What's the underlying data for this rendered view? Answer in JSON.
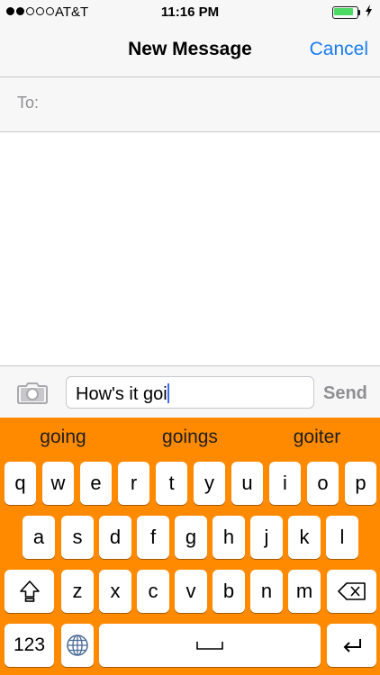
{
  "status_bar": {
    "signal_filled": 2,
    "signal_total": 5,
    "carrier": "AT&T",
    "time": "11:16 PM",
    "battery_level": 0.9,
    "battery_color": "#4cd964",
    "charging_icon": "bolt-icon"
  },
  "nav": {
    "title": "New Message",
    "cancel_label": "Cancel",
    "accent_color": "#1a7cf2"
  },
  "recipient": {
    "label": "To:",
    "value": ""
  },
  "compose": {
    "camera_icon": "camera-icon",
    "text": "How's it goi",
    "send_label": "Send"
  },
  "keyboard": {
    "theme_color": "#ff8a00",
    "suggestions": [
      "going",
      "goings",
      "goiter"
    ],
    "row1": [
      "q",
      "w",
      "e",
      "r",
      "t",
      "y",
      "u",
      "i",
      "o",
      "p"
    ],
    "row2": [
      "a",
      "s",
      "d",
      "f",
      "g",
      "h",
      "j",
      "k",
      "l"
    ],
    "row3": [
      "z",
      "x",
      "c",
      "v",
      "b",
      "n",
      "m"
    ],
    "shift_icon": "shift-icon",
    "delete_icon": "backspace-icon",
    "numbers_label": "123",
    "globe_icon": "globe-icon",
    "space_icon": "space-icon",
    "return_icon": "return-icon"
  }
}
